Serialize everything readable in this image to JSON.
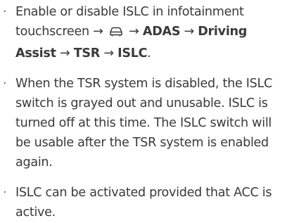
{
  "bullet_char": "·",
  "items": [
    {
      "before": "Enable or disable ISLC in infotainment touchscreen → ",
      "icon": "car-icon",
      "arrow_adas": " → ",
      "adas": "ADAS",
      "arrow_driving": " → ",
      "driving_assist": "Driving Assist",
      "arrow_tsr": " → ",
      "tsr": "TSR",
      "arrow_islc": " → ",
      "islc": "ISLC",
      "end": "."
    },
    {
      "text": "When the TSR system is disabled, the ISLC switch is grayed out and unusable. ISLC is turned off at this time. The ISLC switch will be usable after the TSR system is enabled again."
    },
    {
      "text": "ISLC can be activated provided that ACC is active."
    }
  ]
}
